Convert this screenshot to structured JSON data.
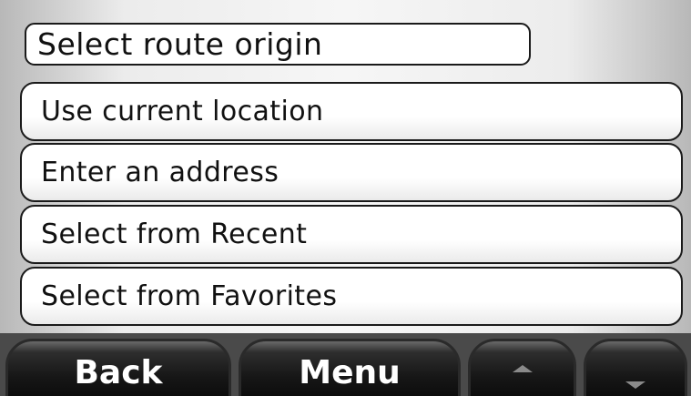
{
  "header": {
    "title": "Select route origin"
  },
  "options": [
    {
      "label": "Use current location"
    },
    {
      "label": "Enter an address"
    },
    {
      "label": "Select from Recent"
    },
    {
      "label": "Select from Favorites"
    }
  ],
  "softkeys": {
    "back_label": "Back",
    "menu_label": "Menu",
    "up_icon": "arrow-up-icon",
    "down_icon": "arrow-down-icon"
  },
  "colors": {
    "softkey_bg": "#111111",
    "softkey_text": "#ffffff",
    "option_bg": "#ffffff",
    "outline": "#1a1a1a"
  }
}
